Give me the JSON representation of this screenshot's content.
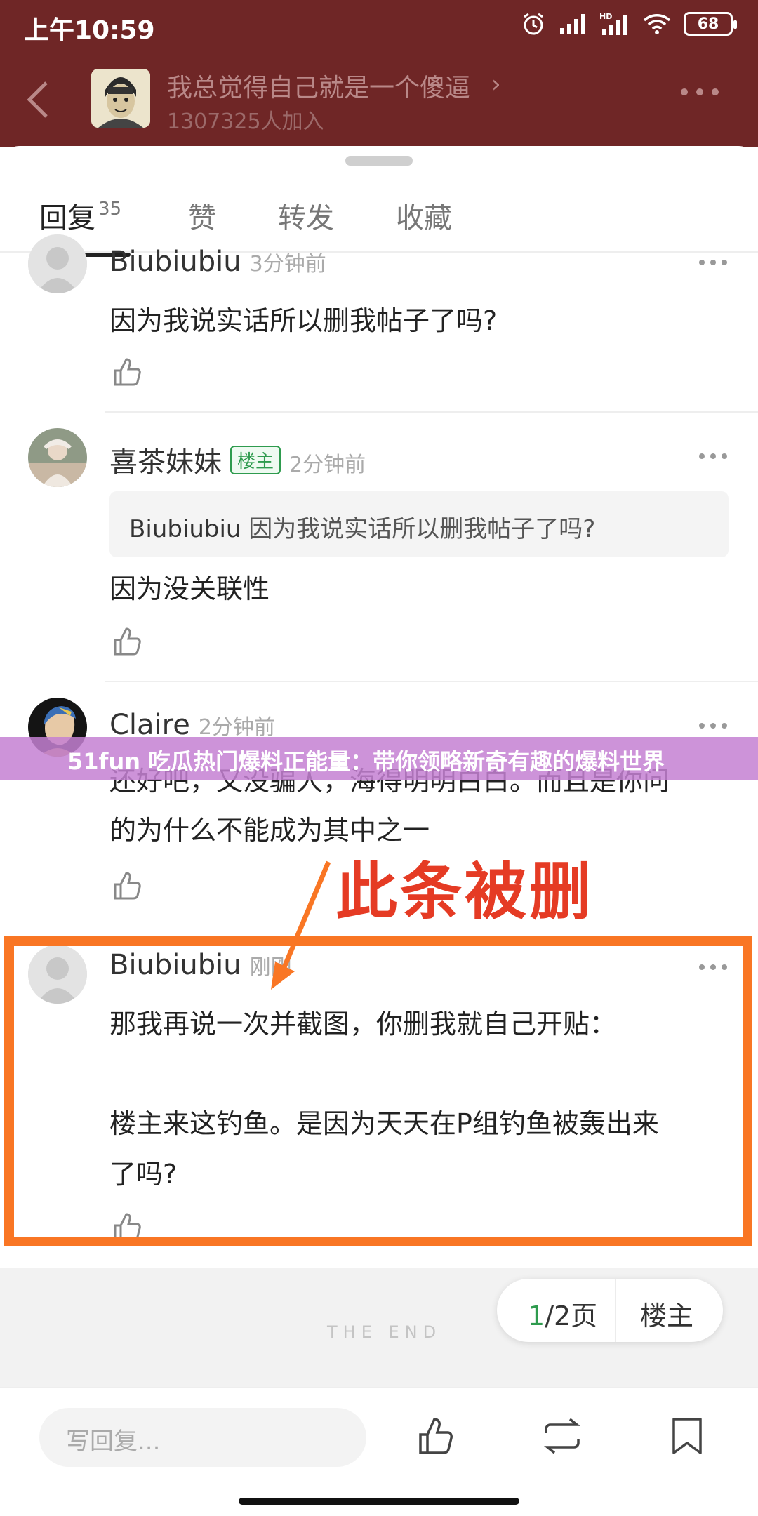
{
  "status": {
    "time": "上午10:59",
    "battery": "68",
    "network": "HD"
  },
  "header": {
    "group_name": "我总觉得自己就是一个傻逼",
    "member_count": "1307325人加入"
  },
  "tabs": [
    {
      "label": "回复",
      "count": "35"
    },
    {
      "label": "赞"
    },
    {
      "label": "转发"
    },
    {
      "label": "收藏"
    }
  ],
  "comments": [
    {
      "name": "Biubiubiu",
      "time": "3分钟前",
      "text": "因为我说实话所以删我帖子了吗?"
    },
    {
      "name": "喜茶妹妹",
      "badge": "楼主",
      "time": "2分钟前",
      "quote_name": "Biubiubiu",
      "quote_text": "因为我说实话所以删我帖子了吗?",
      "text": "因为没关联性"
    },
    {
      "name": "Claire",
      "time": "2分钟前",
      "line1": "还好吧，又没骗人，海得明明白白。而且是你问",
      "line2": "的为什么不能成为其中之一"
    },
    {
      "name": "Biubiubiu",
      "time": "刚刚",
      "line1": "那我再说一次并截图，你删我就自己开贴：",
      "line2": "楼主来这钓鱼。是因为天天在P组钓鱼被轰出来",
      "line3": "了吗?"
    }
  ],
  "banner": "51fun 吃瓜热门爆料正能量：带你领略新奇有趣的爆料世界",
  "annotation": "此条被删",
  "footer": {
    "the_end": "THE END",
    "page_current": "1",
    "page_total": "/2页",
    "owner_only": "楼主"
  },
  "bottom": {
    "reply_placeholder": "写回复..."
  },
  "colors": {
    "header_bg": "#6f2626",
    "accent_orange": "#f97624",
    "annotation_red": "#e53b24",
    "owner_green": "#2e9b4e"
  }
}
